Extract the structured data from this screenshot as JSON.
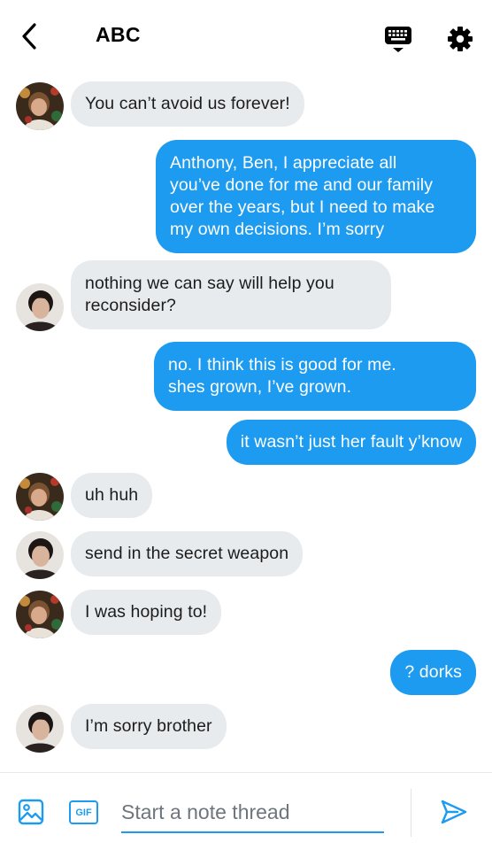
{
  "header": {
    "title": "ABC",
    "back_icon": "back-arrow-icon",
    "keyboard_icon": "keyboard-icon",
    "settings_icon": "gear-icon"
  },
  "messages": [
    {
      "sender": "incoming",
      "avatar": "avatar-1",
      "text": "You can’t avoid us forever!"
    },
    {
      "sender": "outgoing",
      "text": "Anthony, Ben, I appreciate all\nyou’ve done for me and our family\nover the years, but I need to make\nmy own decisions. I’m sorry"
    },
    {
      "sender": "incoming",
      "avatar": "avatar-2",
      "text": "nothing we can say will help you\nreconsider?"
    },
    {
      "sender": "outgoing",
      "text": "no. I think this is good for me.\nshes grown, I’ve grown."
    },
    {
      "sender": "outgoing",
      "text": "it wasn’t just her fault y’know"
    },
    {
      "sender": "incoming",
      "avatar": "avatar-1",
      "text": "uh huh"
    },
    {
      "sender": "incoming",
      "avatar": "avatar-2",
      "text": "send in the secret weapon"
    },
    {
      "sender": "incoming",
      "avatar": "avatar-1",
      "text": "I was hoping to!"
    },
    {
      "sender": "outgoing",
      "text": "? dorks"
    },
    {
      "sender": "incoming",
      "avatar": "avatar-2",
      "text": "I’m sorry brother"
    }
  ],
  "composer": {
    "gif_label": "GIF",
    "placeholder": "Start a note thread",
    "value": "",
    "media_icon": "image-icon",
    "send_icon": "send-icon"
  },
  "colors": {
    "accent": "#1d9bf0",
    "incoming_bubble": "#e8ebee"
  }
}
